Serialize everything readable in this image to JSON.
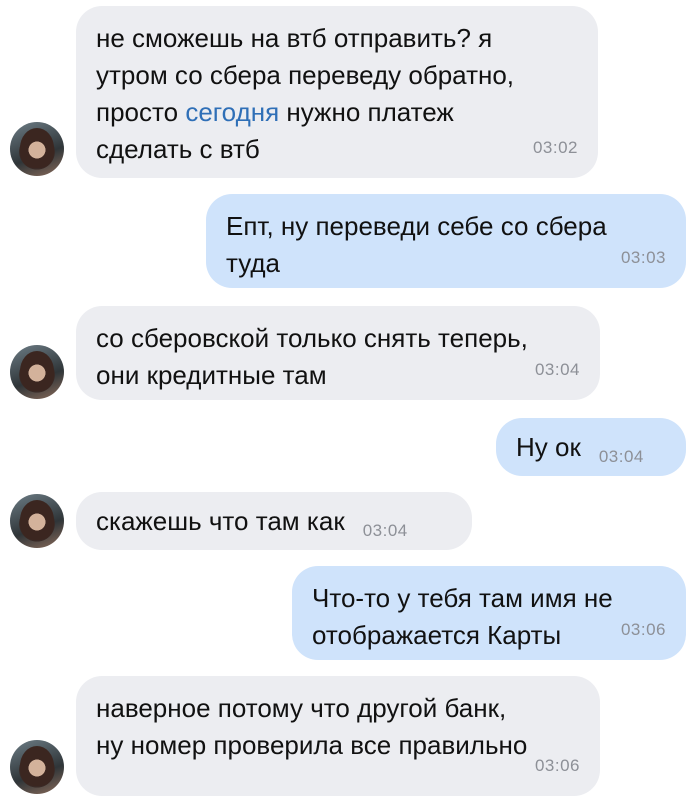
{
  "messages": [
    {
      "dir": "in",
      "parts": [
        "не сможешь на втб отправить? я\nутром со сбера переведу обратно,\nпросто ",
        "сегодня",
        " нужно платеж\nсделать с втб"
      ],
      "time": "03:02"
    },
    {
      "dir": "out",
      "text": "Епт, ну переведи себе со сбера\nтуда",
      "time": "03:03"
    },
    {
      "dir": "in",
      "text": "со сберовской только снять теперь,\nони кредитные там",
      "time": "03:04"
    },
    {
      "dir": "out",
      "text": "Ну ок",
      "time": "03:04"
    },
    {
      "dir": "in",
      "text": "скажешь что там как",
      "time": "03:04"
    },
    {
      "dir": "out",
      "text": "Что-то у тебя там имя не\nотображается Карты",
      "time": "03:06"
    },
    {
      "dir": "in",
      "text": "наверное потому что другой банк,\nну номер проверила все правильно",
      "time": "03:06"
    }
  ]
}
